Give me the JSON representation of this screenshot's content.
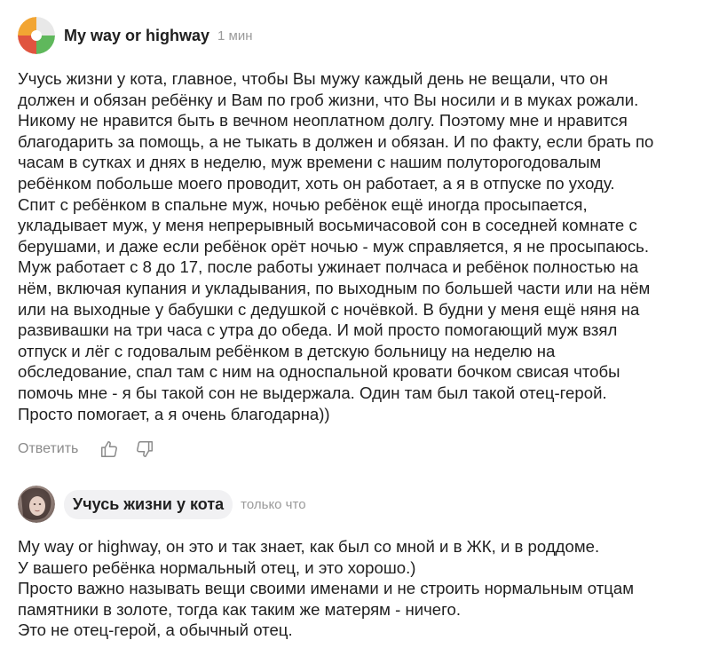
{
  "comments": [
    {
      "author": "My way or highway",
      "time": "1 мин",
      "avatar_icon": "zen-logo-avatar-icon",
      "lines": [
        "Учусь жизни у кота, главное, чтобы Вы мужу каждый день не вещали, что он",
        "должен и обязан ребёнку и Вам по гроб жизни, что Вы носили и в муках рожали.",
        "Никому не нравится быть в вечном неоплатном долгу. Поэтому мне и нравится",
        "благодарить за помощь, а не тыкать в должен и обязан. И по факту, если брать по",
        "часам в сутках и днях в неделю, муж времени с нашим полуторогодовалым",
        "ребёнком побольше моего проводит, хоть он работает, а я в отпуске по уходу.",
        "Спит с ребёнком в спальне муж, ночью ребёнок ещё иногда просыпается,",
        "укладывает муж, у меня непрерывный восьмичасовой сон в соседней комнате с",
        "берушами, и даже если ребёнок орёт ночью - муж справляется, я не просыпаюсь.",
        "Муж работает с 8 до 17, после работы ужинает полчаса и ребёнок полностью на",
        "нём, включая купания и укладывания, по выходным по большей части или на нём",
        "или на выходные у бабушки с дедушкой с ночёвкой. В будни у меня ещё няня на",
        "развивашки на три часа с утра до обеда. И мой просто помогающий муж взял",
        "отпуск и лёг с годовалым ребёнком в детскую больницу на неделю на",
        "обследование, спал там с ним на односпальной кровати бочком свисая чтобы",
        "помочь мне - я бы такой сон не выдержала. Один там был такой отец-герой.",
        "Просто помогает, а я очень благодарна))"
      ],
      "reply_label": "Ответить",
      "like_icon": "thumbs-up-icon",
      "dislike_icon": "thumbs-down-icon"
    },
    {
      "author": "Учусь жизни у кота",
      "time": "только что",
      "avatar_icon": "user-photo-avatar",
      "lines": [
        "My way or highway, он это и так знает, как был со мной и в ЖК, и в роддоме.",
        "У вашего ребёнка нормальный отец, и это хорошо.)",
        "Просто важно называть вещи своими именами и не строить нормальным отцам",
        "памятники в золоте, тогда как таким же матерям - ничего.",
        "Это не отец-герой, а обычный отец."
      ]
    }
  ],
  "colors": {
    "text": "#1f1f1f",
    "muted": "#9a9a9a",
    "pill": "#f1f1f3"
  }
}
